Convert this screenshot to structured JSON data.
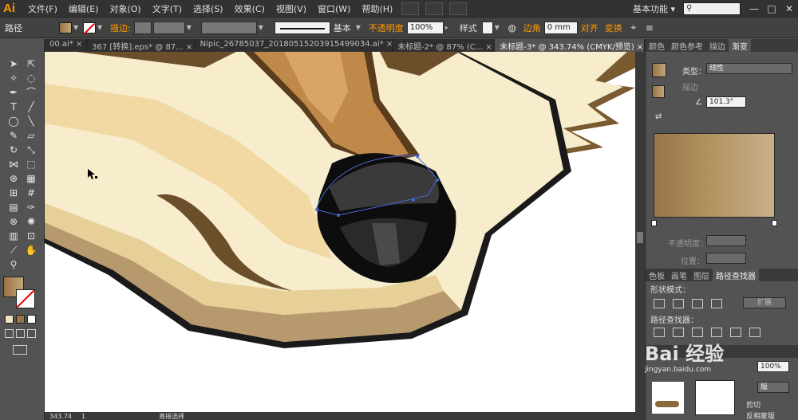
{
  "app": {
    "logo": "Ai"
  },
  "menu": [
    "文件(F)",
    "编辑(E)",
    "对象(O)",
    "文字(T)",
    "选择(S)",
    "效果(C)",
    "视图(V)",
    "窗口(W)",
    "帮助(H)"
  ],
  "workspace": {
    "label": "基本功能",
    "arrow": "▾"
  },
  "window_controls": [
    "—",
    "□",
    "✕"
  ],
  "control": {
    "object_type": "路径",
    "stroke_label": "描边",
    "stroke_colon": ":",
    "stroke_style_label": "基本",
    "opacity_label": "不透明度",
    "opacity_value": "100%",
    "style_label": "样式",
    "corner_label": "边角",
    "corner_value": "0 mm",
    "align_label": "对齐",
    "transform_label": "变换"
  },
  "tabs": [
    "00.ai* ×",
    "367 [转换].eps* @ 87... ×",
    "Nipic_26785037_20180515203915499034.ai* ×",
    "未标题-2* @ 87% (C... ×",
    "未标题-3* @ 343.74% (CMYK/预览) ×"
  ],
  "active_tab": 4,
  "status": {
    "zoom": "343.74",
    "page": "1",
    "tool": "直接选择"
  },
  "panel": {
    "tabs": [
      "颜色",
      "颜色参考",
      "描边",
      "渐变"
    ],
    "active_tab": 3,
    "type_label": "类型：",
    "type_value": "线性",
    "stroke_label": "描边",
    "angle_value": "101.3°",
    "opacity_label": "不透明度：",
    "position_label": "位置：",
    "tabs2": [
      "色板",
      "画笔",
      "图层",
      "路径查找器"
    ],
    "active_tab2": 3,
    "shape_modes_label": "形状模式：",
    "expand_label": "扩展",
    "pathfinder_label": "路径查找器：",
    "bottom_percent": "100%",
    "bottom_btn": "版",
    "clip_label": "剪切",
    "invert_mask_label": "反相蒙版"
  },
  "watermark": {
    "text": "Bai 经验",
    "sub": "jingyan.baidu.com"
  },
  "colors": {
    "fur_dark": "#7a5a30",
    "fur_light": "#f7eccc",
    "nose": "#1a1a1a",
    "gradient_start": "#9a7446",
    "gradient_end": "#c8b08a",
    "accent": "#ff9a00"
  }
}
